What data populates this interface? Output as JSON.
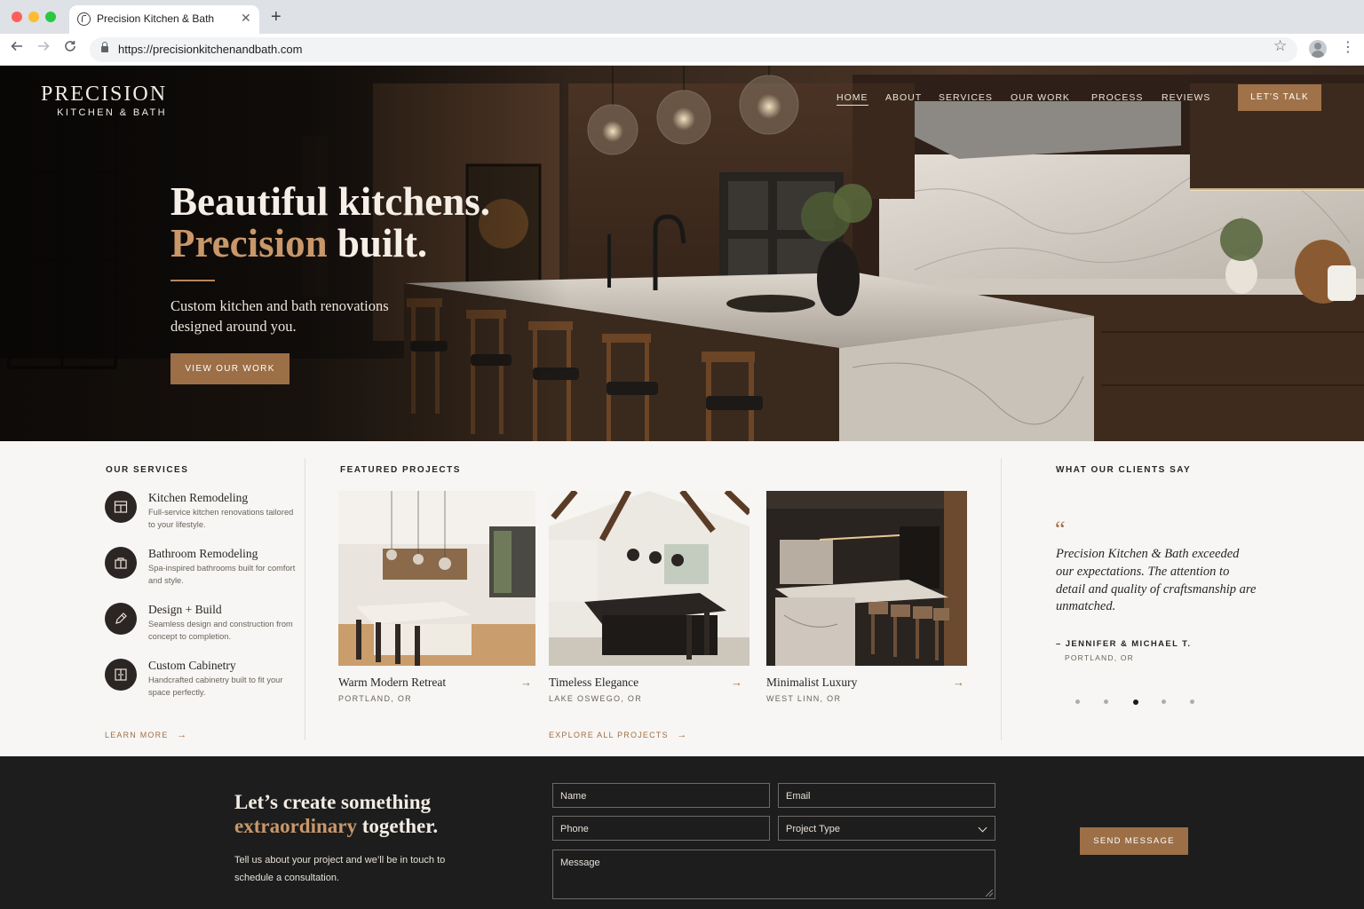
{
  "browser": {
    "tab_title": "Precision Kitchen & Bath",
    "url": "https://precisionkitchenandbath.com",
    "close_glyph": "✕",
    "newtab_glyph": "+",
    "icons": [
      "favicon-icon",
      "close-icon",
      "back-icon",
      "forward-icon",
      "reload-icon",
      "lock-icon",
      "star-icon",
      "profile-icon",
      "menu-icon"
    ]
  },
  "brand": {
    "name": "PRECISION",
    "tagline": "KITCHEN & BATH",
    "accent_color": "#a0724a",
    "dark_color": "#1d1d1d"
  },
  "nav": {
    "items": [
      "HOME",
      "ABOUT",
      "SERVICES",
      "OUR WORK",
      "PROCESS",
      "REVIEWS"
    ],
    "active": "HOME",
    "cta": "LET'S TALK"
  },
  "hero": {
    "line1": "Beautiful kitchens.",
    "line2_accent": "Precision",
    "line2_rest": " built.",
    "subtitle": "Custom kitchen and bath renovations designed around you.",
    "button": "VIEW OUR WORK"
  },
  "services": {
    "heading": "OUR SERVICES",
    "items": [
      {
        "title": "Kitchen Remodeling",
        "desc": "Full-service kitchen renovations tailored to your lifestyle.",
        "icon": "kitchen-icon"
      },
      {
        "title": "Bathroom Remodeling",
        "desc": "Spa-inspired bathrooms built for comfort and style.",
        "icon": "bathroom-icon"
      },
      {
        "title": "Design + Build",
        "desc": "Seamless design and construction from concept to completion.",
        "icon": "pencil-icon"
      },
      {
        "title": "Custom Cabinetry",
        "desc": "Handcrafted cabinetry built to fit your space perfectly.",
        "icon": "cabinet-icon"
      }
    ],
    "link": "LEARN MORE"
  },
  "projects": {
    "heading": "FEATURED PROJECTS",
    "items": [
      {
        "title": "Warm Modern Retreat",
        "location": "PORTLAND, OR"
      },
      {
        "title": "Timeless Elegance",
        "location": "LAKE OSWEGO, OR"
      },
      {
        "title": "Minimalist Luxury",
        "location": "WEST LINN, OR"
      }
    ],
    "link": "EXPLORE ALL PROJECTS"
  },
  "testimonials": {
    "heading": "WHAT OUR CLIENTS SAY",
    "quote_mark": "“",
    "quote": "Precision Kitchen & Bath exceeded our expectations. The attention to detail and quality of craftsmanship are unmatched.",
    "author": "– JENNIFER & MICHAEL T.",
    "location": "PORTLAND, OR",
    "slide_count": 5,
    "active_slide": 3
  },
  "contact": {
    "heading_line1": "Let’s create something",
    "heading_accent": "extraordinary",
    "heading_rest": " together.",
    "text": "Tell us about your project and we’ll be in touch to schedule a consultation.",
    "fields": {
      "name": "Name",
      "email": "Email",
      "phone": "Phone",
      "project_type": "Project Type",
      "message": "Message"
    },
    "button": "SEND MESSAGE"
  },
  "arrow_glyph": "→"
}
